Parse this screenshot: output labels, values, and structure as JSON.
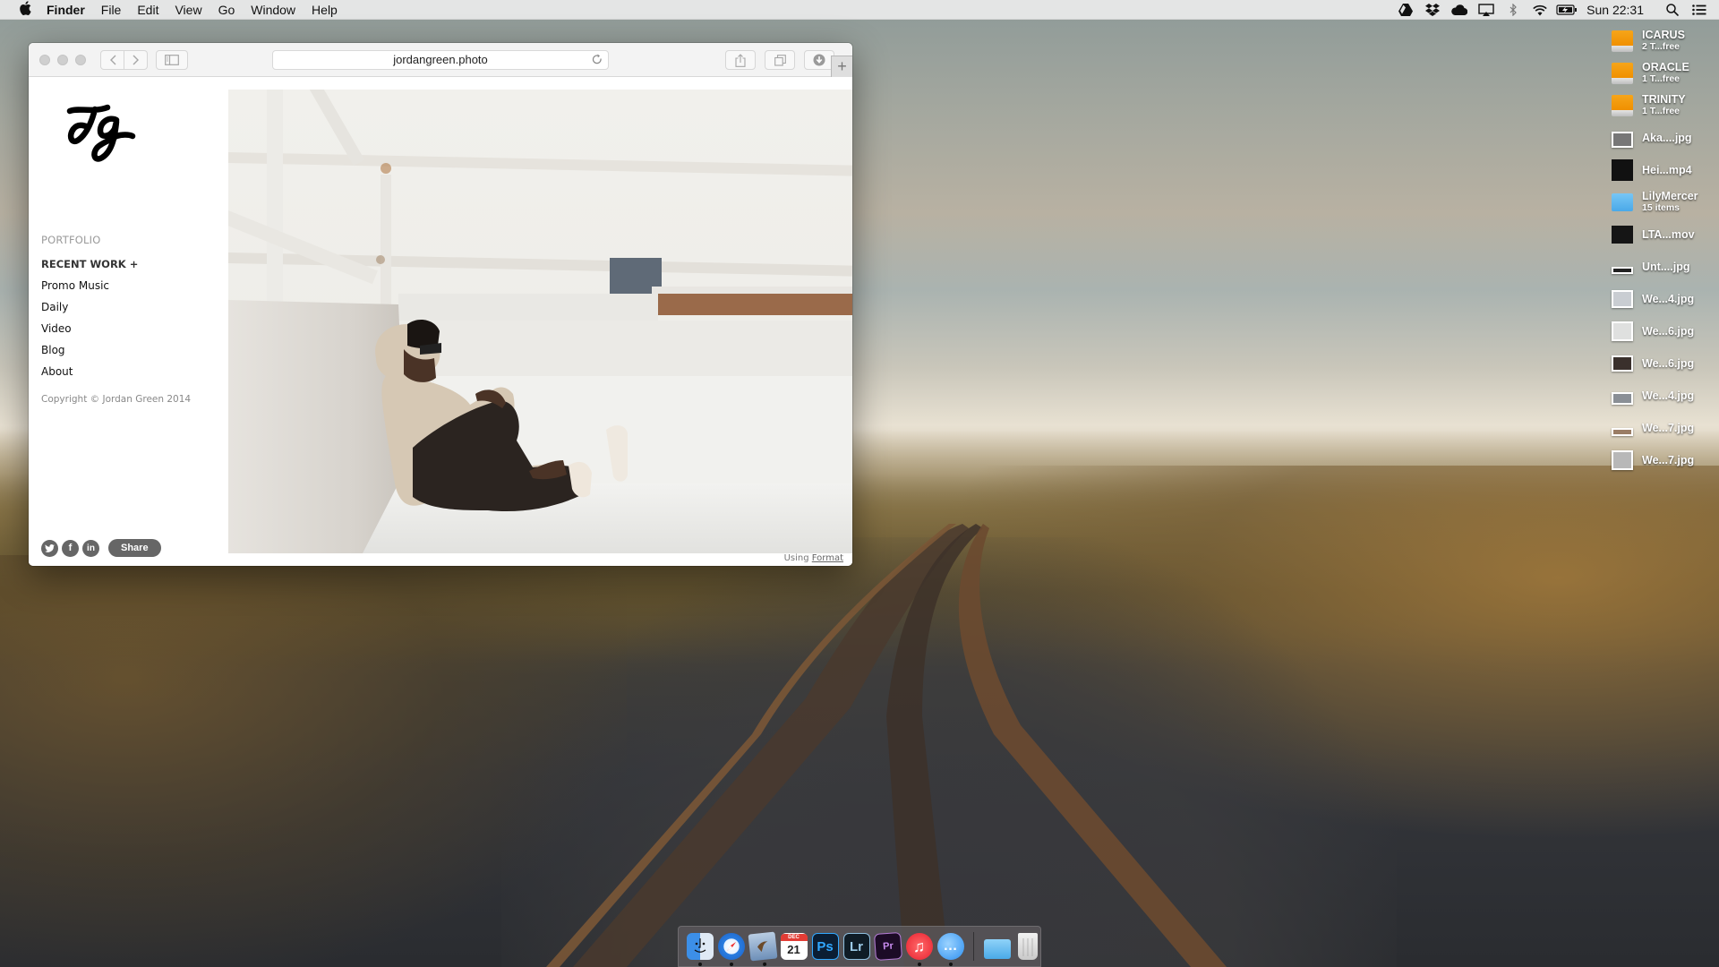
{
  "menubar": {
    "apple_icon": "apple-logo",
    "app_name": "Finder",
    "menus": [
      "File",
      "Edit",
      "View",
      "Go",
      "Window",
      "Help"
    ],
    "status_icons": [
      "google-drive-icon",
      "dropbox-icon",
      "icloud-icon",
      "airplay-icon",
      "bluetooth-icon",
      "wifi-icon",
      "battery-charging-icon"
    ],
    "clock": "Sun 22:31",
    "spotlight_icon": "search-icon",
    "notification_icon": "list-icon"
  },
  "browser": {
    "url": "jordangreen.photo",
    "toolbar_icons": [
      "back-icon",
      "forward-icon",
      "sidebar-icon",
      "reload-icon",
      "share-icon",
      "tabs-icon",
      "downloads-icon",
      "new-tab-icon"
    ],
    "new_tab_label": "+"
  },
  "website": {
    "logo_text": "JG",
    "nav": {
      "header": "PORTFOLIO",
      "section": "RECENT WORK +",
      "links": [
        "Promo Music",
        "Daily",
        "Video",
        "Blog",
        "About"
      ]
    },
    "copyright": "Copyright © Jordan Green 2014",
    "social": {
      "twitter": "t",
      "facebook": "f",
      "linkedin": "in",
      "share_label": "Share"
    },
    "photo_alt": "Man in sunglasses sitting against a white rooftop wall",
    "footer_prefix": "Using",
    "footer_link": "Format"
  },
  "desktop_items": [
    {
      "name": "ICARUS",
      "sub": "2 T...free",
      "kind": "drive"
    },
    {
      "name": "ORACLE",
      "sub": "1 T...free",
      "kind": "drive"
    },
    {
      "name": "TRINITY",
      "sub": "1 T...free",
      "kind": "drive"
    },
    {
      "name": "Aka....jpg",
      "sub": "",
      "kind": "image"
    },
    {
      "name": "Hei...mp4",
      "sub": "",
      "kind": "video"
    },
    {
      "name": "LilyMercer",
      "sub": "15 items",
      "kind": "folder"
    },
    {
      "name": "LTA...mov",
      "sub": "",
      "kind": "video"
    },
    {
      "name": "Unt....jpg",
      "sub": "",
      "kind": "image"
    },
    {
      "name": "We...4.jpg",
      "sub": "",
      "kind": "image"
    },
    {
      "name": "We...6.jpg",
      "sub": "",
      "kind": "image"
    },
    {
      "name": "We...6.jpg",
      "sub": "",
      "kind": "image"
    },
    {
      "name": "We...4.jpg",
      "sub": "",
      "kind": "image"
    },
    {
      "name": "We...7.jpg",
      "sub": "",
      "kind": "image"
    },
    {
      "name": "We...7.jpg",
      "sub": "",
      "kind": "image"
    }
  ],
  "dock": {
    "apps": [
      {
        "name": "Finder",
        "icon": "finder-icon",
        "running": true,
        "glyph": ""
      },
      {
        "name": "Safari",
        "icon": "safari-icon",
        "running": true,
        "glyph": ""
      },
      {
        "name": "Mail",
        "icon": "mail-icon",
        "running": true,
        "glyph": ""
      },
      {
        "name": "Calendar",
        "icon": "calendar-icon",
        "running": false,
        "glyph": "21",
        "month": "DEC"
      },
      {
        "name": "Photoshop",
        "icon": "photoshop-icon",
        "running": false,
        "glyph": "Ps"
      },
      {
        "name": "Lightroom",
        "icon": "lightroom-icon",
        "running": false,
        "glyph": "Lr"
      },
      {
        "name": "Premiere Pro",
        "icon": "premiere-icon",
        "running": false,
        "glyph": "Pr"
      },
      {
        "name": "iTunes",
        "icon": "itunes-icon",
        "running": true,
        "glyph": "♫"
      },
      {
        "name": "Messages",
        "icon": "messages-icon",
        "running": true,
        "glyph": "…"
      }
    ],
    "stacks": [
      {
        "name": "Documents",
        "icon": "documents-folder-icon"
      },
      {
        "name": "Trash",
        "icon": "trash-icon"
      }
    ]
  }
}
